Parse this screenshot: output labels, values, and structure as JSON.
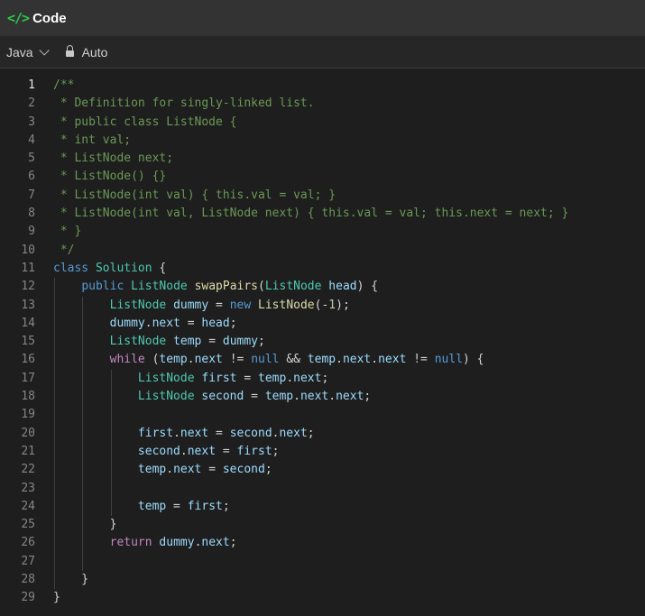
{
  "header": {
    "icon": "</>",
    "title": "Code"
  },
  "toolbar": {
    "language": "Java",
    "mode": "Auto"
  },
  "editor": {
    "active_line": 1,
    "lines": [
      {
        "n": "1",
        "t": [
          [
            "/**",
            "comment"
          ]
        ]
      },
      {
        "n": "2",
        "t": [
          [
            " * Definition for singly-linked list.",
            "comment"
          ]
        ]
      },
      {
        "n": "3",
        "t": [
          [
            " * public class ListNode {",
            "comment"
          ]
        ]
      },
      {
        "n": "4",
        "t": [
          [
            " * int val;",
            "comment"
          ]
        ]
      },
      {
        "n": "5",
        "t": [
          [
            " * ListNode next;",
            "comment"
          ]
        ]
      },
      {
        "n": "6",
        "t": [
          [
            " * ListNode() {}",
            "comment"
          ]
        ]
      },
      {
        "n": "7",
        "t": [
          [
            " * ListNode(int val) { this.val = val; }",
            "comment"
          ]
        ]
      },
      {
        "n": "8",
        "t": [
          [
            " * ListNode(int val, ListNode next) { this.val = val; this.next = next; }",
            "comment"
          ]
        ]
      },
      {
        "n": "9",
        "t": [
          [
            " * }",
            "comment"
          ]
        ]
      },
      {
        "n": "10",
        "t": [
          [
            " */",
            "comment"
          ]
        ]
      },
      {
        "n": "11",
        "t": [
          [
            "class",
            "kw"
          ],
          [
            " ",
            "plain"
          ],
          [
            "Solution",
            "type"
          ],
          [
            " {",
            "plain"
          ]
        ]
      },
      {
        "n": "12",
        "t": [
          [
            "    ",
            "plain"
          ],
          [
            "public",
            "kw"
          ],
          [
            " ",
            "plain"
          ],
          [
            "ListNode",
            "type"
          ],
          [
            " ",
            "plain"
          ],
          [
            "swapPairs",
            "fn"
          ],
          [
            "(",
            "plain"
          ],
          [
            "ListNode",
            "type"
          ],
          [
            " ",
            "plain"
          ],
          [
            "head",
            "var"
          ],
          [
            ") {",
            "plain"
          ]
        ]
      },
      {
        "n": "13",
        "t": [
          [
            "        ",
            "plain"
          ],
          [
            "ListNode",
            "type"
          ],
          [
            " ",
            "plain"
          ],
          [
            "dummy",
            "var"
          ],
          [
            " = ",
            "plain"
          ],
          [
            "new",
            "kw"
          ],
          [
            " ",
            "plain"
          ],
          [
            "ListNode",
            "fn"
          ],
          [
            "(-",
            "plain"
          ],
          [
            "1",
            "num"
          ],
          [
            ");",
            "plain"
          ]
        ]
      },
      {
        "n": "14",
        "t": [
          [
            "        ",
            "plain"
          ],
          [
            "dummy",
            "var"
          ],
          [
            ".",
            "plain"
          ],
          [
            "next",
            "var"
          ],
          [
            " = ",
            "plain"
          ],
          [
            "head",
            "var"
          ],
          [
            ";",
            "plain"
          ]
        ]
      },
      {
        "n": "15",
        "t": [
          [
            "        ",
            "plain"
          ],
          [
            "ListNode",
            "type"
          ],
          [
            " ",
            "plain"
          ],
          [
            "temp",
            "var"
          ],
          [
            " = ",
            "plain"
          ],
          [
            "dummy",
            "var"
          ],
          [
            ";",
            "plain"
          ]
        ]
      },
      {
        "n": "16",
        "t": [
          [
            "        ",
            "plain"
          ],
          [
            "while",
            "ctrl"
          ],
          [
            " (",
            "plain"
          ],
          [
            "temp",
            "var"
          ],
          [
            ".",
            "plain"
          ],
          [
            "next",
            "var"
          ],
          [
            " != ",
            "plain"
          ],
          [
            "null",
            "kw"
          ],
          [
            " && ",
            "plain"
          ],
          [
            "temp",
            "var"
          ],
          [
            ".",
            "plain"
          ],
          [
            "next",
            "var"
          ],
          [
            ".",
            "plain"
          ],
          [
            "next",
            "var"
          ],
          [
            " != ",
            "plain"
          ],
          [
            "null",
            "kw"
          ],
          [
            ") {",
            "plain"
          ]
        ]
      },
      {
        "n": "17",
        "t": [
          [
            "            ",
            "plain"
          ],
          [
            "ListNode",
            "type"
          ],
          [
            " ",
            "plain"
          ],
          [
            "first",
            "var"
          ],
          [
            " = ",
            "plain"
          ],
          [
            "temp",
            "var"
          ],
          [
            ".",
            "plain"
          ],
          [
            "next",
            "var"
          ],
          [
            ";",
            "plain"
          ]
        ]
      },
      {
        "n": "18",
        "t": [
          [
            "            ",
            "plain"
          ],
          [
            "ListNode",
            "type"
          ],
          [
            " ",
            "plain"
          ],
          [
            "second",
            "var"
          ],
          [
            " = ",
            "plain"
          ],
          [
            "temp",
            "var"
          ],
          [
            ".",
            "plain"
          ],
          [
            "next",
            "var"
          ],
          [
            ".",
            "plain"
          ],
          [
            "next",
            "var"
          ],
          [
            ";",
            "plain"
          ]
        ]
      },
      {
        "n": "19",
        "t": []
      },
      {
        "n": "20",
        "t": [
          [
            "            ",
            "plain"
          ],
          [
            "first",
            "var"
          ],
          [
            ".",
            "plain"
          ],
          [
            "next",
            "var"
          ],
          [
            " = ",
            "plain"
          ],
          [
            "second",
            "var"
          ],
          [
            ".",
            "plain"
          ],
          [
            "next",
            "var"
          ],
          [
            ";",
            "plain"
          ]
        ]
      },
      {
        "n": "21",
        "t": [
          [
            "            ",
            "plain"
          ],
          [
            "second",
            "var"
          ],
          [
            ".",
            "plain"
          ],
          [
            "next",
            "var"
          ],
          [
            " = ",
            "plain"
          ],
          [
            "first",
            "var"
          ],
          [
            ";",
            "plain"
          ]
        ]
      },
      {
        "n": "22",
        "t": [
          [
            "            ",
            "plain"
          ],
          [
            "temp",
            "var"
          ],
          [
            ".",
            "plain"
          ],
          [
            "next",
            "var"
          ],
          [
            " = ",
            "plain"
          ],
          [
            "second",
            "var"
          ],
          [
            ";",
            "plain"
          ]
        ]
      },
      {
        "n": "23",
        "t": []
      },
      {
        "n": "24",
        "t": [
          [
            "            ",
            "plain"
          ],
          [
            "temp",
            "var"
          ],
          [
            " = ",
            "plain"
          ],
          [
            "first",
            "var"
          ],
          [
            ";",
            "plain"
          ]
        ]
      },
      {
        "n": "25",
        "t": [
          [
            "        }",
            "plain"
          ]
        ]
      },
      {
        "n": "26",
        "t": [
          [
            "        ",
            "plain"
          ],
          [
            "return",
            "ctrl"
          ],
          [
            " ",
            "plain"
          ],
          [
            "dummy",
            "var"
          ],
          [
            ".",
            "plain"
          ],
          [
            "next",
            "var"
          ],
          [
            ";",
            "plain"
          ]
        ]
      },
      {
        "n": "27",
        "t": []
      },
      {
        "n": "28",
        "t": [
          [
            "    }",
            "plain"
          ]
        ]
      },
      {
        "n": "29",
        "t": [
          [
            "}",
            "plain"
          ]
        ]
      }
    ]
  }
}
